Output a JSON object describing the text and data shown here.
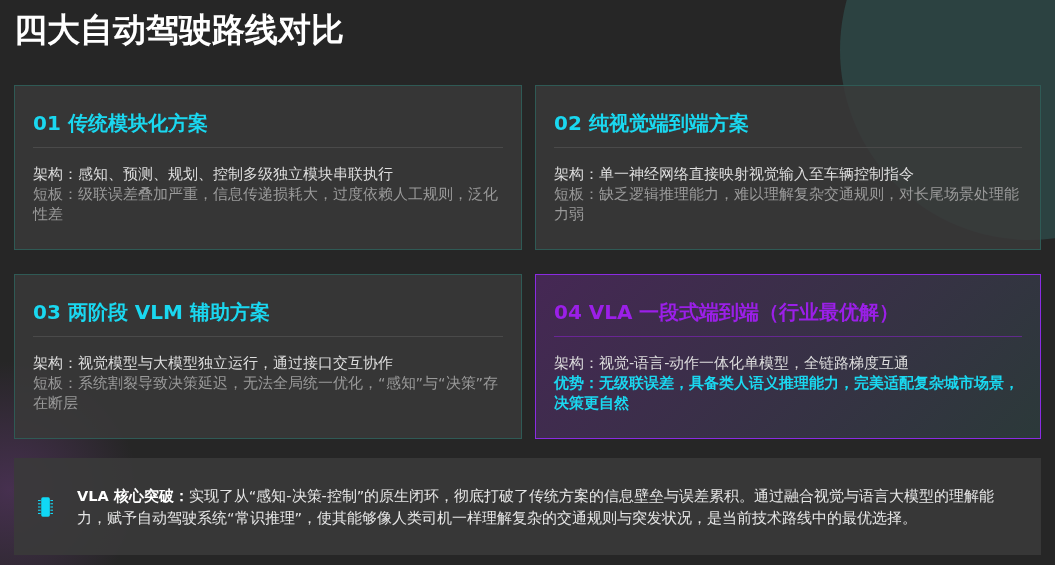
{
  "title": "四大自动驾驶路线对比",
  "cards": [
    {
      "title": "01 传统模块化方案",
      "highlighted": false,
      "lines": [
        {
          "kind": "architecture",
          "text": "架构：感知、预测、规划、控制多级独立模块串联执行"
        },
        {
          "kind": "weakness",
          "text": "短板：级联误差叠加严重，信息传递损耗大，过度依赖人工规则，泛化性差"
        }
      ]
    },
    {
      "title": "02 纯视觉端到端方案",
      "highlighted": false,
      "lines": [
        {
          "kind": "architecture",
          "text": "架构：单一神经网络直接映射视觉输入至车辆控制指令"
        },
        {
          "kind": "weakness",
          "text": "短板：缺乏逻辑推理能力，难以理解复杂交通规则，对长尾场景处理能力弱"
        }
      ]
    },
    {
      "title": "03 两阶段 VLM 辅助方案",
      "highlighted": false,
      "lines": [
        {
          "kind": "architecture",
          "text": "架构：视觉模型与大模型独立运行，通过接口交互协作"
        },
        {
          "kind": "weakness",
          "text": "短板：系统割裂导致决策延迟，无法全局统一优化，“感知”与“决策”存在断层"
        }
      ]
    },
    {
      "title": "04 VLA 一段式端到端（行业最优解）",
      "highlighted": true,
      "lines": [
        {
          "kind": "architecture",
          "text": "架构：视觉-语言-动作一体化单模型，全链路梯度互通"
        },
        {
          "kind": "advantage",
          "text": "优势：无级联误差，具备类人语义推理能力，完美适配复杂城市场景，决策更自然"
        }
      ]
    }
  ],
  "summary": {
    "text": "**VLA 核心突破：**实现了从“感知-决策-控制”的原生闭环，彻底打破了传统方案的信息壁垒与误差累积。通过融合视觉与语言大模型的理解能力，赋予自动驾驶系统“常识推理”，使其能够像人类司机一样理解复杂的交通规则与突发状况，是当前技术路线中的最优选择。"
  }
}
